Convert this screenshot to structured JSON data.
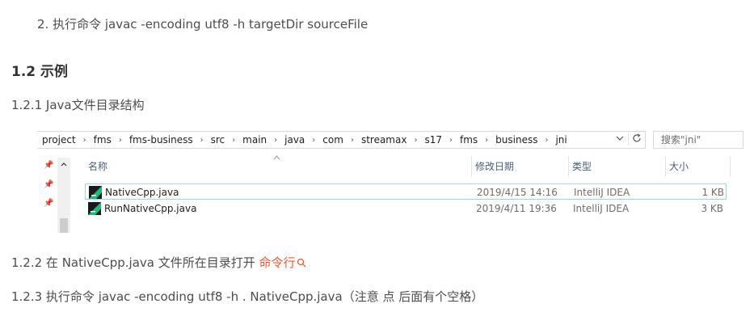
{
  "doc": {
    "step2": "2. 执行命令  javac  -encoding  utf8  -h targetDir   sourceFile",
    "heading": "1.2 示例",
    "sub121": "1.2.1 Java文件目录结构",
    "sub122_prefix": "1.2.2  在 NativeCpp.java 文件所在目录打开 ",
    "sub122_link": "命令行",
    "sub123": "1.2.3  执行命令 javac -encoding utf8 -h . NativeCpp.java（注意 点 后面有个空格）",
    "link_color": "#fc5531",
    "link_icon": "search-icon"
  },
  "explorer": {
    "breadcrumbs": [
      "project",
      "fms",
      "fms-business",
      "src",
      "main",
      "java",
      "com",
      "streamax",
      "s17",
      "fms",
      "business",
      "jni"
    ],
    "search_placeholder": "搜索\"jni\"",
    "icons": {
      "dropdown": "chevron-down-icon",
      "refresh": "refresh-icon",
      "pin": "pin-icon",
      "file": "intellij-file-icon",
      "sort": "sort-up-icon"
    },
    "columns": [
      "名称",
      "修改日期",
      "类型",
      "大小"
    ],
    "files": [
      {
        "name": "NativeCpp.java",
        "date": "2019/4/15 14:16",
        "type": "IntelliJ IDEA",
        "size": "1 KB",
        "selected": true
      },
      {
        "name": "RunNativeCpp.java",
        "date": "2019/4/11 19:36",
        "type": "IntelliJ IDEA",
        "size": "3 KB",
        "selected": false
      }
    ],
    "selection_border": "#99d1ff"
  }
}
